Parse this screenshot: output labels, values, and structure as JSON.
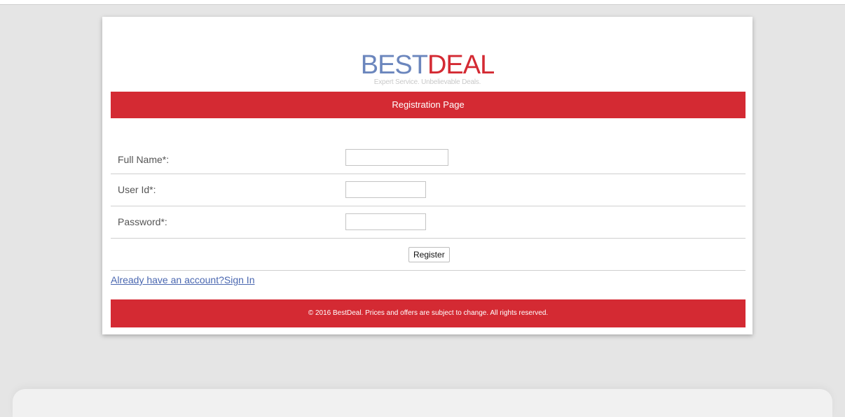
{
  "top_strip": {
    "text": ""
  },
  "logo": {
    "best": "BEST",
    "deal": "DEAL",
    "tagline": "Expert Service. Unbelievable Deals."
  },
  "header": {
    "title": "Registration Page"
  },
  "form": {
    "full_name": {
      "label": "Full Name*:",
      "value": ""
    },
    "user_id": {
      "label": "User Id*:",
      "value": ""
    },
    "password": {
      "label": "Password*:",
      "value": ""
    },
    "register_label": "Register"
  },
  "signin": {
    "prefix": "Already have an account?",
    "link": "Sign In"
  },
  "footer": {
    "text": "© 2016 BestDeal. Prices and offers are subject to change. All rights reserved."
  },
  "colors": {
    "brand_red": "#d42a33",
    "brand_blue": "#6b86bd",
    "link_blue": "#4a67b0",
    "page_background": "#e5e5e5"
  }
}
